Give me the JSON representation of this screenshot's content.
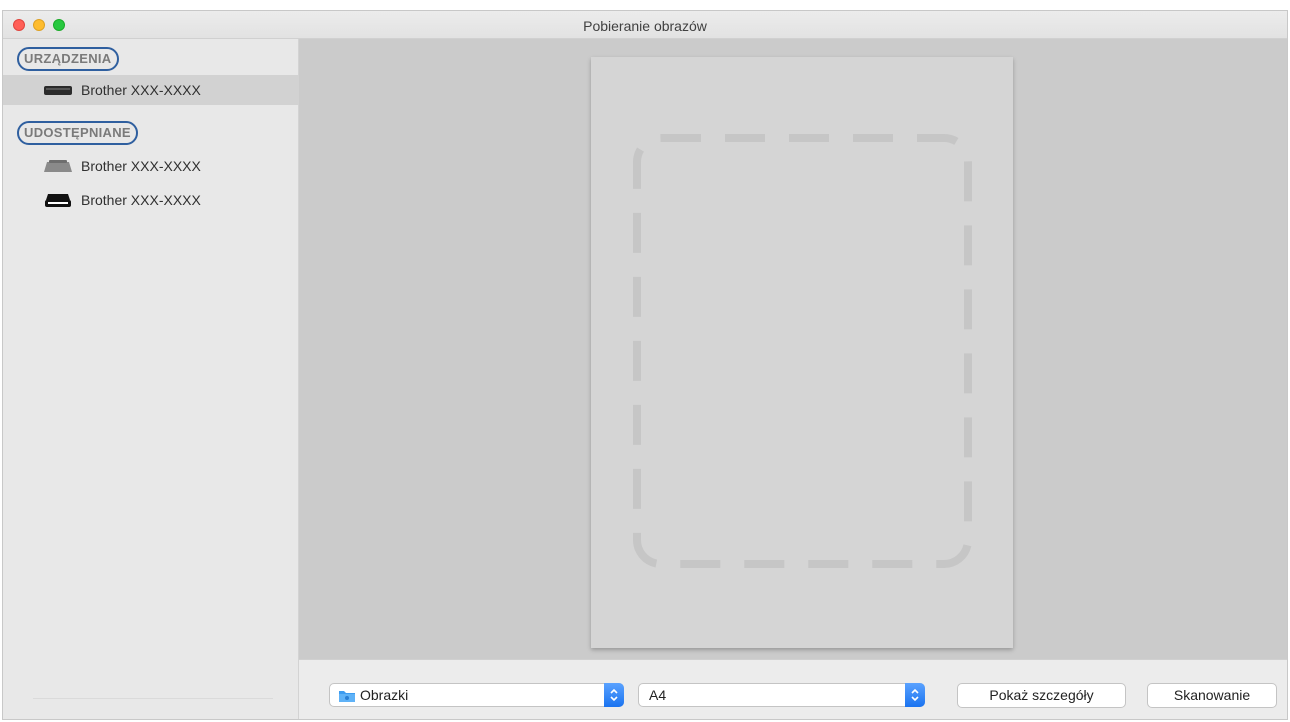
{
  "window": {
    "title": "Pobieranie obrazów"
  },
  "sidebar": {
    "sections": [
      {
        "header": "URZĄDZENIA",
        "items": [
          {
            "label": "Brother XXX-XXXX",
            "icon": "scanner-icon",
            "selected": true
          }
        ]
      },
      {
        "header": "UDOSTĘPNIANE",
        "items": [
          {
            "label": "Brother XXX-XXXX",
            "icon": "shared-scanner-icon",
            "selected": false
          },
          {
            "label": "Brother XXX-XXXX",
            "icon": "printer-icon",
            "selected": false
          }
        ]
      }
    ]
  },
  "bottom_bar": {
    "destination": {
      "value": "Obrazki",
      "icon": "folder-icon"
    },
    "paper_size": {
      "value": "A4"
    },
    "show_details_label": "Pokaż szczegóły",
    "scan_label": "Skanowanie"
  },
  "colors": {
    "accent": "#1a73f0",
    "highlight_outline": "#2f5f9f",
    "traffic_close": "#ff5f57",
    "traffic_minimize": "#febc2e",
    "traffic_maximize": "#28c840"
  }
}
